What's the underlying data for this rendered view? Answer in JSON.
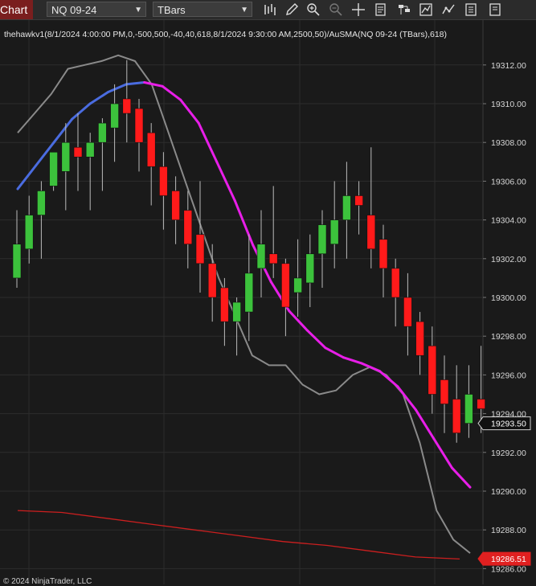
{
  "toolbar": {
    "tab_label": "Chart",
    "instrument": "NQ 09-24",
    "bar_type": "TBars",
    "icons": [
      "bar-type-icon",
      "draw-icon",
      "zoom-in-icon",
      "zoom-out-icon",
      "crosshair-icon",
      "data-box-icon",
      "strategies-icon",
      "indicators-icon",
      "templates-icon",
      "properties-icon",
      "more-icon"
    ]
  },
  "indicator_label": "thehawkv1(8/1/2024 4:00:00 PM,0,-500,500,-40,40,618,8/1/2024 9:30:00 AM,2500,50)/AuSMA(NQ 09-24 (TBars),618)",
  "copyright": "© 2024 NinjaTrader, LLC",
  "colors": {
    "up": "#3cc23c",
    "down": "#ff1a1a",
    "magenta": "#e81ee8",
    "blue": "#4a6ce0",
    "gray": "#8a8a8a",
    "red_line": "#cc1f1f",
    "grid": "#2c2c2c"
  },
  "chart_data": {
    "type": "candlestick",
    "instrument": "NQ 09-24 (TBars)",
    "ylim": [
      19285.5,
      19313.5
    ],
    "y_ticks": [
      "19286.00",
      "19288.00",
      "19290.00",
      "19292.00",
      "19294.00",
      "19296.00",
      "19298.00",
      "19300.00",
      "19302.00",
      "19304.00",
      "19306.00",
      "19308.00",
      "19310.00",
      "19312.00"
    ],
    "price_markers": [
      {
        "label": "19293.50",
        "value": 19293.5,
        "style": "current"
      },
      {
        "label": "19286.51",
        "value": 19286.51,
        "style": "red"
      }
    ],
    "candles": [
      {
        "o": 19301.0,
        "h": 19304.5,
        "l": 19300.5,
        "c": 19302.75
      },
      {
        "o": 19302.5,
        "h": 19305.25,
        "l": 19301.75,
        "c": 19304.25
      },
      {
        "o": 19304.25,
        "h": 19306.0,
        "l": 19302.0,
        "c": 19305.5
      },
      {
        "o": 19305.75,
        "h": 19307.5,
        "l": 19305.5,
        "c": 19307.5
      },
      {
        "o": 19306.5,
        "h": 19309.0,
        "l": 19304.5,
        "c": 19308.0
      },
      {
        "o": 19307.75,
        "h": 19309.5,
        "l": 19305.5,
        "c": 19307.25
      },
      {
        "o": 19307.25,
        "h": 19308.5,
        "l": 19304.5,
        "c": 19308.0
      },
      {
        "o": 19308.0,
        "h": 19309.25,
        "l": 19305.5,
        "c": 19309.0
      },
      {
        "o": 19308.75,
        "h": 19311.0,
        "l": 19307.0,
        "c": 19310.0
      },
      {
        "o": 19310.25,
        "h": 19312.25,
        "l": 19308.0,
        "c": 19309.5
      },
      {
        "o": 19309.75,
        "h": 19310.25,
        "l": 19306.5,
        "c": 19308.0
      },
      {
        "o": 19308.5,
        "h": 19309.0,
        "l": 19304.75,
        "c": 19306.75
      },
      {
        "o": 19306.75,
        "h": 19307.5,
        "l": 19303.5,
        "c": 19305.25
      },
      {
        "o": 19305.5,
        "h": 19306.25,
        "l": 19302.75,
        "c": 19304.0
      },
      {
        "o": 19304.5,
        "h": 19305.5,
        "l": 19301.5,
        "c": 19302.75
      },
      {
        "o": 19303.25,
        "h": 19306.0,
        "l": 19300.25,
        "c": 19301.75
      },
      {
        "o": 19301.75,
        "h": 19302.75,
        "l": 19298.75,
        "c": 19300.0
      },
      {
        "o": 19300.5,
        "h": 19301.0,
        "l": 19297.5,
        "c": 19298.75
      },
      {
        "o": 19298.75,
        "h": 19300.0,
        "l": 19297.0,
        "c": 19299.75
      },
      {
        "o": 19299.25,
        "h": 19303.25,
        "l": 19297.75,
        "c": 19301.25
      },
      {
        "o": 19301.5,
        "h": 19304.5,
        "l": 19300.0,
        "c": 19302.75
      },
      {
        "o": 19302.25,
        "h": 19305.75,
        "l": 19301.0,
        "c": 19301.75
      },
      {
        "o": 19301.75,
        "h": 19302.0,
        "l": 19298.0,
        "c": 19299.5
      },
      {
        "o": 19300.25,
        "h": 19303.0,
        "l": 19299.0,
        "c": 19301.0
      },
      {
        "o": 19300.75,
        "h": 19303.25,
        "l": 19299.5,
        "c": 19302.25
      },
      {
        "o": 19302.25,
        "h": 19304.5,
        "l": 19300.5,
        "c": 19303.75
      },
      {
        "o": 19302.75,
        "h": 19306.0,
        "l": 19301.5,
        "c": 19304.0
      },
      {
        "o": 19304.0,
        "h": 19307.0,
        "l": 19302.0,
        "c": 19305.25
      },
      {
        "o": 19305.25,
        "h": 19306.0,
        "l": 19303.25,
        "c": 19304.75
      },
      {
        "o": 19304.25,
        "h": 19307.75,
        "l": 19301.5,
        "c": 19302.5
      },
      {
        "o": 19303.0,
        "h": 19303.75,
        "l": 19300.0,
        "c": 19301.5
      },
      {
        "o": 19301.5,
        "h": 19302.0,
        "l": 19298.5,
        "c": 19300.0
      },
      {
        "o": 19300.0,
        "h": 19301.25,
        "l": 19297.0,
        "c": 19298.5
      },
      {
        "o": 19298.75,
        "h": 19299.25,
        "l": 19296.0,
        "c": 19297.0
      },
      {
        "o": 19297.5,
        "h": 19298.5,
        "l": 19294.0,
        "c": 19295.0
      },
      {
        "o": 19295.75,
        "h": 19297.0,
        "l": 19293.0,
        "c": 19294.5
      },
      {
        "o": 19294.75,
        "h": 19296.5,
        "l": 19292.5,
        "c": 19293.0
      },
      {
        "o": 19293.5,
        "h": 19296.5,
        "l": 19292.75,
        "c": 19295.0
      },
      {
        "o": 19294.75,
        "h": 19297.5,
        "l": 19293.0,
        "c": 19294.25
      }
    ],
    "ausma_618": [
      19289.0,
      19288.9,
      19288.6,
      19288.3,
      19288.0,
      19287.7,
      19287.4,
      19287.2,
      19286.9,
      19286.6,
      19286.5
    ],
    "band_gray": [
      19308.5,
      19309.5,
      19310.5,
      19311.8,
      19312.0,
      19312.2,
      19312.5,
      19312.2,
      19311.0,
      19308.5,
      19306.0,
      19303.5,
      19301.0,
      19299.0,
      19297.0,
      19296.5,
      19296.5,
      19295.5,
      19295.0,
      19295.2,
      19296.0,
      19296.4,
      19296.0,
      19295.0,
      19292.5,
      19289.0,
      19287.5,
      19286.8
    ],
    "main_line": [
      19305.6,
      19306.8,
      19308.0,
      19309.2,
      19310.0,
      19310.6,
      19311.0,
      19311.1,
      19310.9,
      19310.2,
      19309.0,
      19307.0,
      19305.0,
      19302.7,
      19300.8,
      19299.3,
      19298.3,
      19297.4,
      19296.9,
      19296.6,
      19296.2,
      19295.4,
      19294.2,
      19292.7,
      19291.2,
      19290.2
    ],
    "main_line_colors": [
      "blue",
      "blue",
      "blue",
      "blue",
      "blue",
      "blue",
      "blue",
      "magenta",
      "magenta",
      "magenta",
      "magenta",
      "magenta",
      "magenta",
      "magenta",
      "magenta",
      "magenta",
      "magenta",
      "magenta",
      "magenta",
      "magenta",
      "magenta",
      "magenta",
      "magenta",
      "magenta",
      "magenta",
      "magenta"
    ]
  }
}
